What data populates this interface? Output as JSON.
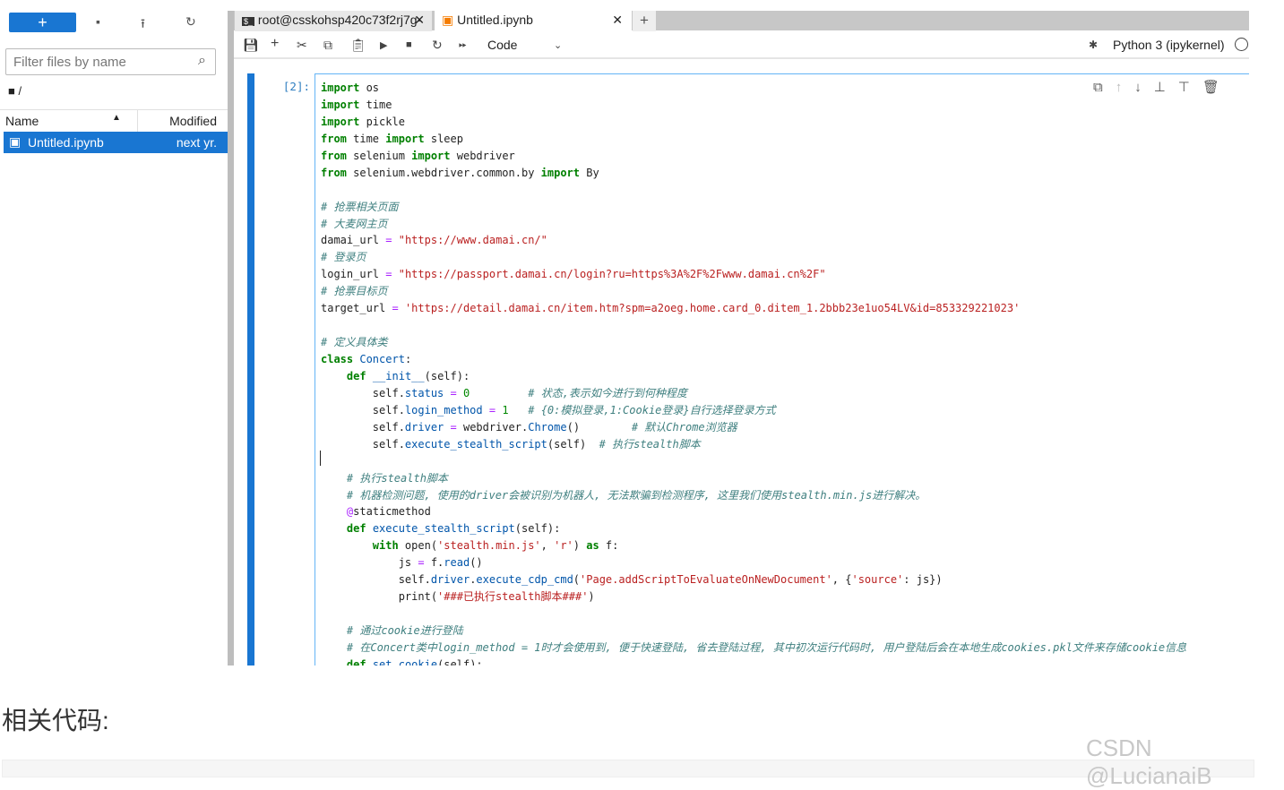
{
  "filebrowser": {
    "new_label": "+",
    "filter_placeholder": "Filter files by name",
    "breadcrumb": "/",
    "columns": {
      "name": "Name",
      "modified": "Modified"
    },
    "files": [
      {
        "name": "Untitled.ipynb",
        "modified": "next yr."
      }
    ]
  },
  "tabs": [
    {
      "label": "root@csskohsp420c73f2rj7g·",
      "icon": "terminal-icon"
    },
    {
      "label": "Untitled.ipynb",
      "icon": "notebook-icon",
      "active": true
    }
  ],
  "toolbar": {
    "cell_type": "Code",
    "kernel": "Python 3 (ipykernel)"
  },
  "notebook": {
    "cell": {
      "prompt": "[2]:",
      "lines": [
        [
          [
            "k",
            "import"
          ],
          [
            "t",
            " os"
          ]
        ],
        [
          [
            "k",
            "import"
          ],
          [
            "t",
            " time"
          ]
        ],
        [
          [
            "k",
            "import"
          ],
          [
            "t",
            " pickle"
          ]
        ],
        [
          [
            "k",
            "from"
          ],
          [
            "t",
            " time "
          ],
          [
            "k",
            "import"
          ],
          [
            "t",
            " sleep"
          ]
        ],
        [
          [
            "k",
            "from"
          ],
          [
            "t",
            " selenium "
          ],
          [
            "k",
            "import"
          ],
          [
            "t",
            " webdriver"
          ]
        ],
        [
          [
            "k",
            "from"
          ],
          [
            "t",
            " selenium.webdriver.common.by "
          ],
          [
            "k",
            "import"
          ],
          [
            "t",
            " By"
          ]
        ],
        [],
        [
          [
            "c",
            "# 抢票相关页面"
          ]
        ],
        [
          [
            "c",
            "# 大麦网主页"
          ]
        ],
        [
          [
            "t",
            "damai_url "
          ],
          [
            "o",
            "="
          ],
          [
            "t",
            " "
          ],
          [
            "s",
            "\"https://www.damai.cn/\""
          ]
        ],
        [
          [
            "c",
            "# 登录页"
          ]
        ],
        [
          [
            "t",
            "login_url "
          ],
          [
            "o",
            "="
          ],
          [
            "t",
            " "
          ],
          [
            "s",
            "\"https://passport.damai.cn/login?ru=https%3A%2F%2Fwww.damai.cn%2F\""
          ]
        ],
        [
          [
            "c",
            "# 抢票目标页"
          ]
        ],
        [
          [
            "t",
            "target_url "
          ],
          [
            "o",
            "="
          ],
          [
            "t",
            " "
          ],
          [
            "s",
            "'https://detail.damai.cn/item.htm?spm=a2oeg.home.card_0.ditem_1.2bbb23e1uo54LV&id=853329221023'"
          ]
        ],
        [],
        [
          [
            "c",
            "# 定义具体类"
          ]
        ],
        [
          [
            "k",
            "class"
          ],
          [
            "t",
            " "
          ],
          [
            "p",
            "Concert"
          ],
          [
            "t",
            ":"
          ]
        ],
        [
          [
            "t",
            "    "
          ],
          [
            "k",
            "def"
          ],
          [
            "t",
            " "
          ],
          [
            "p",
            "__init__"
          ],
          [
            "t",
            "(self):"
          ]
        ],
        [
          [
            "t",
            "        self."
          ],
          [
            "p",
            "status"
          ],
          [
            "t",
            " "
          ],
          [
            "o",
            "="
          ],
          [
            "t",
            " "
          ],
          [
            "n",
            "0"
          ],
          [
            "t",
            "         "
          ],
          [
            "c",
            "# 状态,表示如今进行到何种程度"
          ]
        ],
        [
          [
            "t",
            "        self."
          ],
          [
            "p",
            "login_method"
          ],
          [
            "t",
            " "
          ],
          [
            "o",
            "="
          ],
          [
            "t",
            " "
          ],
          [
            "n",
            "1"
          ],
          [
            "t",
            "   "
          ],
          [
            "c",
            "# {0:模拟登录,1:Cookie登录}自行选择登录方式"
          ]
        ],
        [
          [
            "t",
            "        self."
          ],
          [
            "p",
            "driver"
          ],
          [
            "t",
            " "
          ],
          [
            "o",
            "="
          ],
          [
            "t",
            " webdriver."
          ],
          [
            "p",
            "Chrome"
          ],
          [
            "t",
            "()        "
          ],
          [
            "c",
            "# 默认Chrome浏览器"
          ]
        ],
        [
          [
            "t",
            "        self."
          ],
          [
            "p",
            "execute_stealth_script"
          ],
          [
            "t",
            "(self)  "
          ],
          [
            "c",
            "# 执行stealth脚本"
          ]
        ],
        [],
        [
          [
            "t",
            "    "
          ],
          [
            "c",
            "# 执行stealth脚本"
          ]
        ],
        [
          [
            "t",
            "    "
          ],
          [
            "c",
            "# 机器检测问题, 使用的driver会被识别为机器人, 无法欺骗到检测程序, 这里我们使用stealth.min.js进行解决。"
          ]
        ],
        [
          [
            "t",
            "    "
          ],
          [
            "o",
            "@"
          ],
          [
            "t",
            "staticmethod"
          ]
        ],
        [
          [
            "t",
            "    "
          ],
          [
            "k",
            "def"
          ],
          [
            "t",
            " "
          ],
          [
            "p",
            "execute_stealth_script"
          ],
          [
            "t",
            "(self):"
          ]
        ],
        [
          [
            "t",
            "        "
          ],
          [
            "k",
            "with"
          ],
          [
            "t",
            " open("
          ],
          [
            "s",
            "'stealth.min.js'"
          ],
          [
            "t",
            ", "
          ],
          [
            "s",
            "'r'"
          ],
          [
            "t",
            ") "
          ],
          [
            "k",
            "as"
          ],
          [
            "t",
            " f:"
          ]
        ],
        [
          [
            "t",
            "            js "
          ],
          [
            "o",
            "="
          ],
          [
            "t",
            " f."
          ],
          [
            "p",
            "read"
          ],
          [
            "t",
            "()"
          ]
        ],
        [
          [
            "t",
            "            self."
          ],
          [
            "p",
            "driver"
          ],
          [
            "t",
            "."
          ],
          [
            "p",
            "execute_cdp_cmd"
          ],
          [
            "t",
            "("
          ],
          [
            "s",
            "'Page.addScriptToEvaluateOnNewDocument'"
          ],
          [
            "t",
            ", {"
          ],
          [
            "s",
            "'source'"
          ],
          [
            "t",
            ": js})"
          ]
        ],
        [
          [
            "t",
            "            print("
          ],
          [
            "s",
            "'###已执行stealth脚本###'"
          ],
          [
            "t",
            ")"
          ]
        ],
        [],
        [
          [
            "t",
            "    "
          ],
          [
            "c",
            "# 通过cookie进行登陆"
          ]
        ],
        [
          [
            "t",
            "    "
          ],
          [
            "c",
            "# 在Concert类中login_method = 1时才会使用到, 便于快速登陆, 省去登陆过程, 其中初次运行代码时, 用户登陆后会在本地生成cookies.pkl文件来存储cookie信息"
          ]
        ],
        [
          [
            "t",
            "    "
          ],
          [
            "k",
            "def"
          ],
          [
            "t",
            " "
          ],
          [
            "p",
            "set_cookie"
          ],
          [
            "t",
            "(self):"
          ]
        ]
      ]
    }
  },
  "article": {
    "heading": "相关代码:"
  },
  "watermark": "CSDN @LucianaiB",
  "colors": {
    "accent": "#1976d2"
  }
}
